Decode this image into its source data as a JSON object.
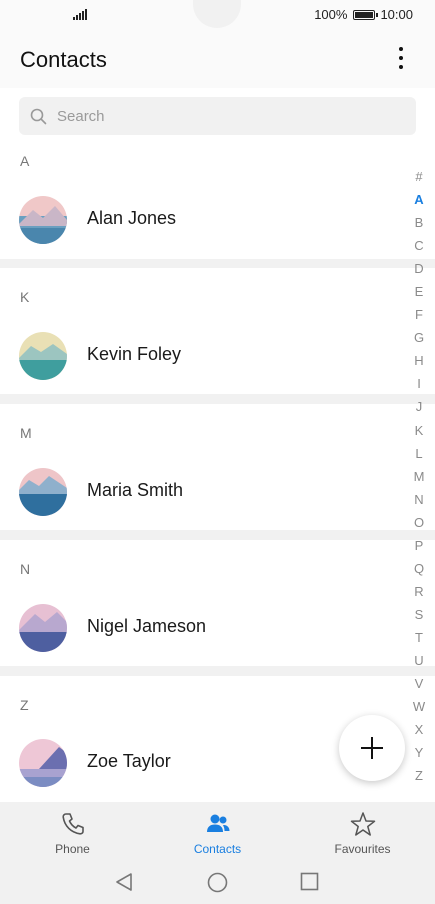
{
  "status_bar": {
    "battery_text": "100%",
    "time": "10:00"
  },
  "header": {
    "title": "Contacts",
    "more_icon": "more-vert-icon"
  },
  "search": {
    "placeholder": "Search",
    "value": ""
  },
  "sections": [
    {
      "letter": "A",
      "contacts": [
        {
          "name": "Alan Jones"
        }
      ]
    },
    {
      "letter": "K",
      "contacts": [
        {
          "name": "Kevin Foley"
        }
      ]
    },
    {
      "letter": "M",
      "contacts": [
        {
          "name": "Maria Smith"
        }
      ]
    },
    {
      "letter": "N",
      "contacts": [
        {
          "name": "Nigel Jameson"
        }
      ]
    },
    {
      "letter": "Z",
      "contacts": [
        {
          "name": "Zoe Taylor"
        }
      ]
    }
  ],
  "index_letters": [
    "#",
    "A",
    "B",
    "C",
    "D",
    "E",
    "F",
    "G",
    "H",
    "I",
    "J",
    "K",
    "L",
    "M",
    "N",
    "O",
    "P",
    "Q",
    "R",
    "S",
    "T",
    "U",
    "V",
    "W",
    "X",
    "Y",
    "Z"
  ],
  "index_active": "A",
  "fab": {
    "icon": "plus-icon"
  },
  "bottom_nav": {
    "tabs": [
      {
        "label": "Phone",
        "icon": "phone-icon",
        "active": false
      },
      {
        "label": "Contacts",
        "icon": "contacts-icon",
        "active": true
      },
      {
        "label": "Favourites",
        "icon": "star-icon",
        "active": false
      }
    ]
  },
  "colors": {
    "accent": "#1a7fe0",
    "background": "#f1f1f1",
    "surface": "#ffffff"
  }
}
